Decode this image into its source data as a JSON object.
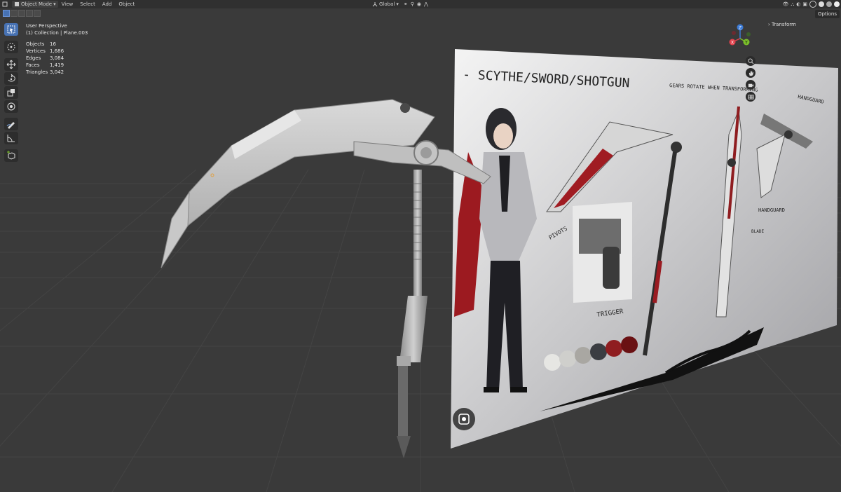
{
  "header": {
    "mode_label": "Object Mode",
    "menus": [
      "View",
      "Select",
      "Add",
      "Object"
    ],
    "transform_orientation": "Global"
  },
  "sidebar": {
    "transform_tab": "Transform",
    "options_label": "Options"
  },
  "viewport": {
    "view_name": "User Perspective",
    "collection_info": "(1) Collection | Plane.003",
    "stats": [
      {
        "label": "Objects",
        "value": "16"
      },
      {
        "label": "Vertices",
        "value": "1,686"
      },
      {
        "label": "Edges",
        "value": "3,084"
      },
      {
        "label": "Faces",
        "value": "1,419"
      },
      {
        "label": "Triangles",
        "value": "3,042"
      }
    ]
  },
  "gizmo": {
    "x": "X",
    "y": "Y",
    "z": "Z"
  },
  "reference_sheet": {
    "title": "- SCYTHE/SWORD/SHOTGUN",
    "note_gears": "GEARS ROTATE WHEN TRANSFORMING",
    "note_handguard": "HANDGUARD",
    "note_pivots": "PIVOTS",
    "note_trigger": "TRIGGER",
    "note_handguard2": "HANDGUARD",
    "note_blade": "BLADE",
    "swatches": [
      "#e6e6e3",
      "#cfcfcc",
      "#a9a7a2",
      "#3b3d42",
      "#8f1d20",
      "#6a1113"
    ]
  },
  "colors": {
    "accent": "#4772b3",
    "axis_x": "#e2424d",
    "axis_y": "#7bbf2a",
    "axis_z": "#3c7bd6"
  },
  "icons": [
    "select-icon",
    "cursor-icon",
    "move-icon",
    "rotate-icon",
    "scale-icon",
    "transform-icon",
    "annotate-icon",
    "measure-icon",
    "add-cube-icon",
    "zoom-icon",
    "hand-icon",
    "camera-icon",
    "grid-icon",
    "screenshot-icon"
  ]
}
